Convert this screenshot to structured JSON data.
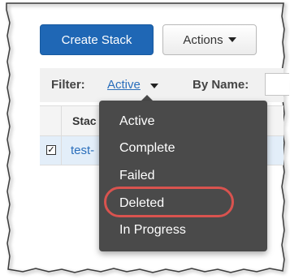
{
  "toolbar": {
    "create_stack_label": "Create Stack",
    "actions_label": "Actions"
  },
  "filter": {
    "label": "Filter:",
    "selected": "Active",
    "by_name_label": "By Name:"
  },
  "table": {
    "header_stack": "Stac",
    "rows": [
      {
        "checked": true,
        "name": "test-"
      }
    ]
  },
  "dropdown": {
    "items": [
      "Active",
      "Complete",
      "Failed",
      "Deleted",
      "In Progress"
    ],
    "highlighted_item": "Deleted",
    "highlight_color": "#d9534f"
  },
  "colors": {
    "primary": "#1f67b5",
    "link": "#2a6ebb",
    "menu_bg": "#4a4a4a"
  }
}
